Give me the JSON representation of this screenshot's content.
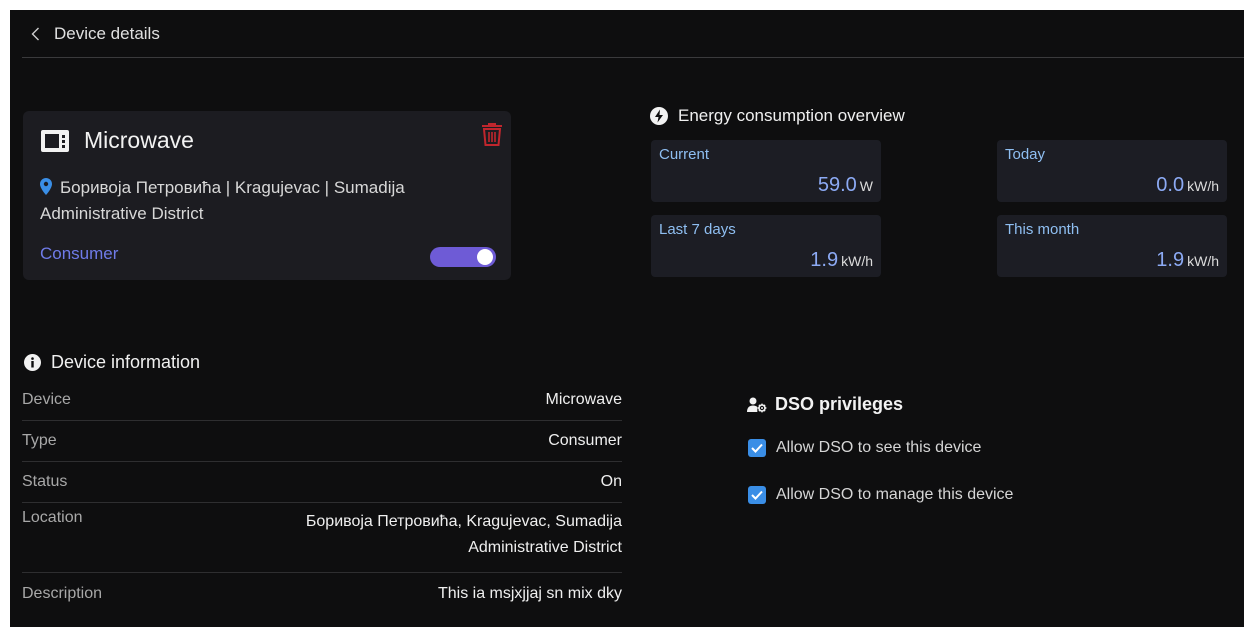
{
  "header": {
    "title": "Device details"
  },
  "device_card": {
    "name": "Microwave",
    "location": "Боривоја Петровића | Kragujevac | Sumadija Administrative District",
    "type_label": "Consumer",
    "toggle_on": true
  },
  "energy": {
    "title": "Energy consumption overview",
    "stats": [
      {
        "label": "Current",
        "value": "59.0",
        "unit": "W"
      },
      {
        "label": "Today",
        "value": "0.0",
        "unit": "kW/h"
      },
      {
        "label": "Last 7 days",
        "value": "1.9",
        "unit": "kW/h"
      },
      {
        "label": "This month",
        "value": "1.9",
        "unit": "kW/h"
      }
    ]
  },
  "device_info": {
    "title": "Device information",
    "rows": [
      {
        "key": "Device",
        "value": "Microwave"
      },
      {
        "key": "Type",
        "value": "Consumer"
      },
      {
        "key": "Status",
        "value": "On"
      },
      {
        "key": "Location",
        "value": "Боривоја Петровића, Kragujevac, Sumadija Administrative District"
      },
      {
        "key": "Description",
        "value": "This ia msjxjjaj sn mix dky"
      }
    ]
  },
  "dso": {
    "title": "DSO privileges",
    "options": [
      {
        "label": "Allow DSO to see this device",
        "checked": true
      },
      {
        "label": "Allow DSO to manage this device",
        "checked": true
      }
    ]
  },
  "colors": {
    "background": "#0e0e0f",
    "card": "#1c1c21",
    "accent": "#6e5bd6",
    "link": "#6f7be8",
    "value": "#8caaf4",
    "checkbox": "#3a8ee6",
    "danger": "#c0262d"
  },
  "icons": [
    "chevron-left-icon",
    "microwave-icon",
    "trash-icon",
    "map-pin-icon",
    "lightning-icon",
    "info-icon",
    "users-gear-icon",
    "checkmark-icon"
  ]
}
